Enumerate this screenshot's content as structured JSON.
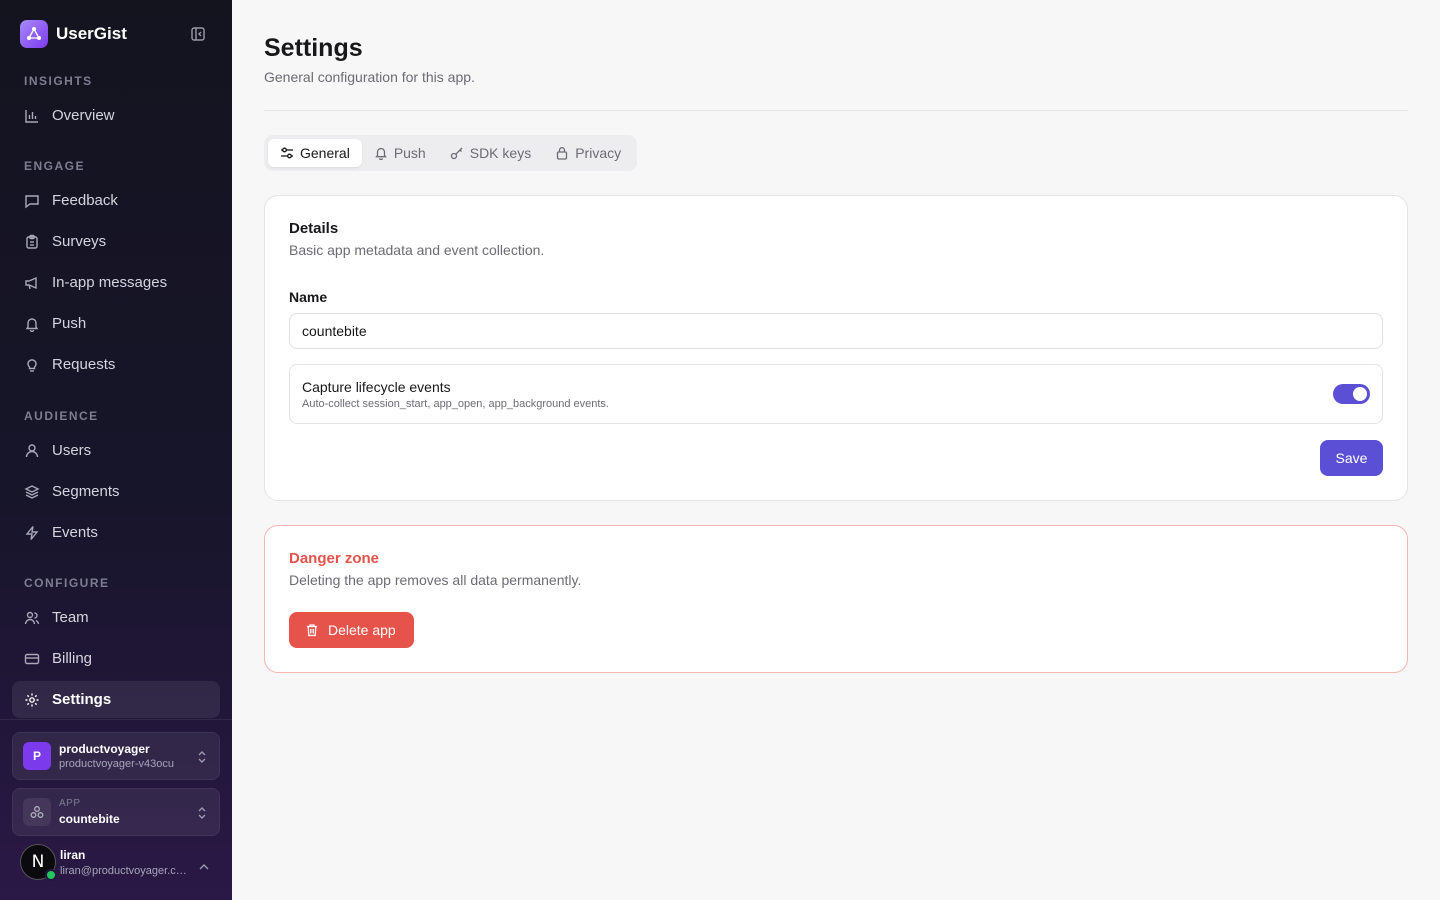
{
  "brand": {
    "name": "UserGist"
  },
  "sidebar": {
    "sections": [
      {
        "label": "INSIGHTS",
        "items": [
          {
            "label": "Overview",
            "icon": "bar-chart-icon"
          }
        ]
      },
      {
        "label": "ENGAGE",
        "items": [
          {
            "label": "Feedback",
            "icon": "message-square-icon"
          },
          {
            "label": "Surveys",
            "icon": "clipboard-icon"
          },
          {
            "label": "In-app messages",
            "icon": "megaphone-icon"
          },
          {
            "label": "Push",
            "icon": "bell-icon"
          },
          {
            "label": "Requests",
            "icon": "lightbulb-icon"
          }
        ]
      },
      {
        "label": "AUDIENCE",
        "items": [
          {
            "label": "Users",
            "icon": "user-icon"
          },
          {
            "label": "Segments",
            "icon": "layers-icon"
          },
          {
            "label": "Events",
            "icon": "zap-icon"
          }
        ]
      },
      {
        "label": "CONFIGURE",
        "items": [
          {
            "label": "Team",
            "icon": "users-icon"
          },
          {
            "label": "Billing",
            "icon": "credit-card-icon"
          },
          {
            "label": "Settings",
            "icon": "gear-icon",
            "active": true
          }
        ]
      }
    ],
    "org": {
      "initial": "P",
      "name": "productvoyager",
      "slug": "productvoyager-v43ocu"
    },
    "app": {
      "label": "APP",
      "name": "countebite"
    },
    "user": {
      "initial": "N",
      "name": "liran",
      "email": "liran@productvoyager.co..."
    }
  },
  "header": {
    "title": "Settings",
    "subtitle": "General configuration for this app."
  },
  "tabs": [
    {
      "label": "General",
      "icon": "sliders-icon",
      "active": true
    },
    {
      "label": "Push",
      "icon": "bell-icon"
    },
    {
      "label": "SDK keys",
      "icon": "key-icon"
    },
    {
      "label": "Privacy",
      "icon": "lock-icon"
    }
  ],
  "details": {
    "title": "Details",
    "description": "Basic app metadata and event collection.",
    "name_label": "Name",
    "name_value": "countebite",
    "lifecycle_title": "Capture lifecycle events",
    "lifecycle_desc": "Auto-collect session_start, app_open, app_background events.",
    "lifecycle_enabled": true,
    "save_label": "Save"
  },
  "danger": {
    "title": "Danger zone",
    "description": "Deleting the app removes all data permanently.",
    "delete_label": "Delete app"
  },
  "colors": {
    "accent": "#5b4fd6",
    "danger": "#e5534b",
    "sidebar_bg": "#14141f"
  }
}
